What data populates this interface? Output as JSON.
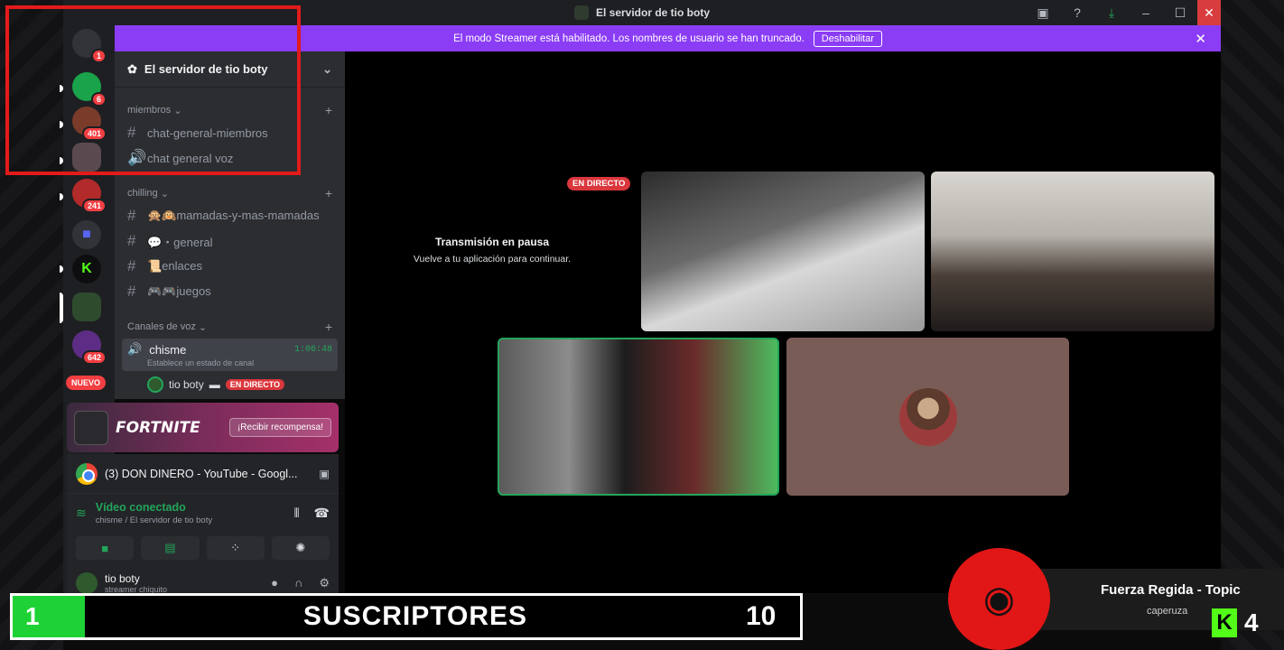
{
  "window": {
    "title": "El servidor de tio boty"
  },
  "banner": {
    "message": "El modo Streamer está habilitado. Los nombres de usuario se han truncado.",
    "action": "Deshabilitar"
  },
  "rail": {
    "badges": [
      "1",
      "6",
      "401",
      "241",
      "642"
    ],
    "new_label": "NUEVO"
  },
  "server": {
    "name": "El servidor de tio boty",
    "categories": [
      {
        "name": "miembros",
        "channels": [
          {
            "type": "text",
            "name": "chat-general-miembros"
          },
          {
            "type": "voice",
            "name": "chat general voz"
          }
        ]
      },
      {
        "name": "chilling",
        "channels": [
          {
            "type": "text",
            "name": "🙊🙉mamadas-y-mas-mamadas"
          },
          {
            "type": "text",
            "name": "💬・general"
          },
          {
            "type": "text",
            "name": "📜enlaces"
          },
          {
            "type": "text",
            "name": "🎮🎮juegos"
          }
        ]
      },
      {
        "name": "Canales de voz",
        "active_voice": {
          "name": "chisme",
          "time": "1:06:48",
          "status_placeholder": "Establece un estado de canal"
        },
        "members": [
          {
            "name": "tio boty",
            "live_label": "EN DIRECTO"
          }
        ]
      }
    ]
  },
  "promo": {
    "game": "FORTNITE",
    "button": "¡Recibir recompensa!"
  },
  "activity": {
    "label": "(3) DON DINERO - YouTube - Googl..."
  },
  "voice": {
    "status": "Vídeo conectado",
    "location": "chisme / El servidor de tio boty"
  },
  "user": {
    "name": "tio boty",
    "status": "streamer chiquito"
  },
  "stage": {
    "paused_title": "Transmisión en pausa",
    "paused_subtitle": "Vuelve a tu aplicación para continuar.",
    "live_label": "EN DIRECTO"
  },
  "overlay": {
    "subs_count": "1",
    "subs_label": "SUSCRIPTORES",
    "subs_goal": "10",
    "song_title": "Fuerza Regida - Topic",
    "song_artist": "caperuza",
    "kick_count": "4"
  },
  "colors": {
    "discord_purple": "#8b3df5",
    "live_red": "#da373c",
    "online_green": "#23a55a",
    "kick_green": "#53fc18",
    "frame_red": "#e21b1b"
  }
}
